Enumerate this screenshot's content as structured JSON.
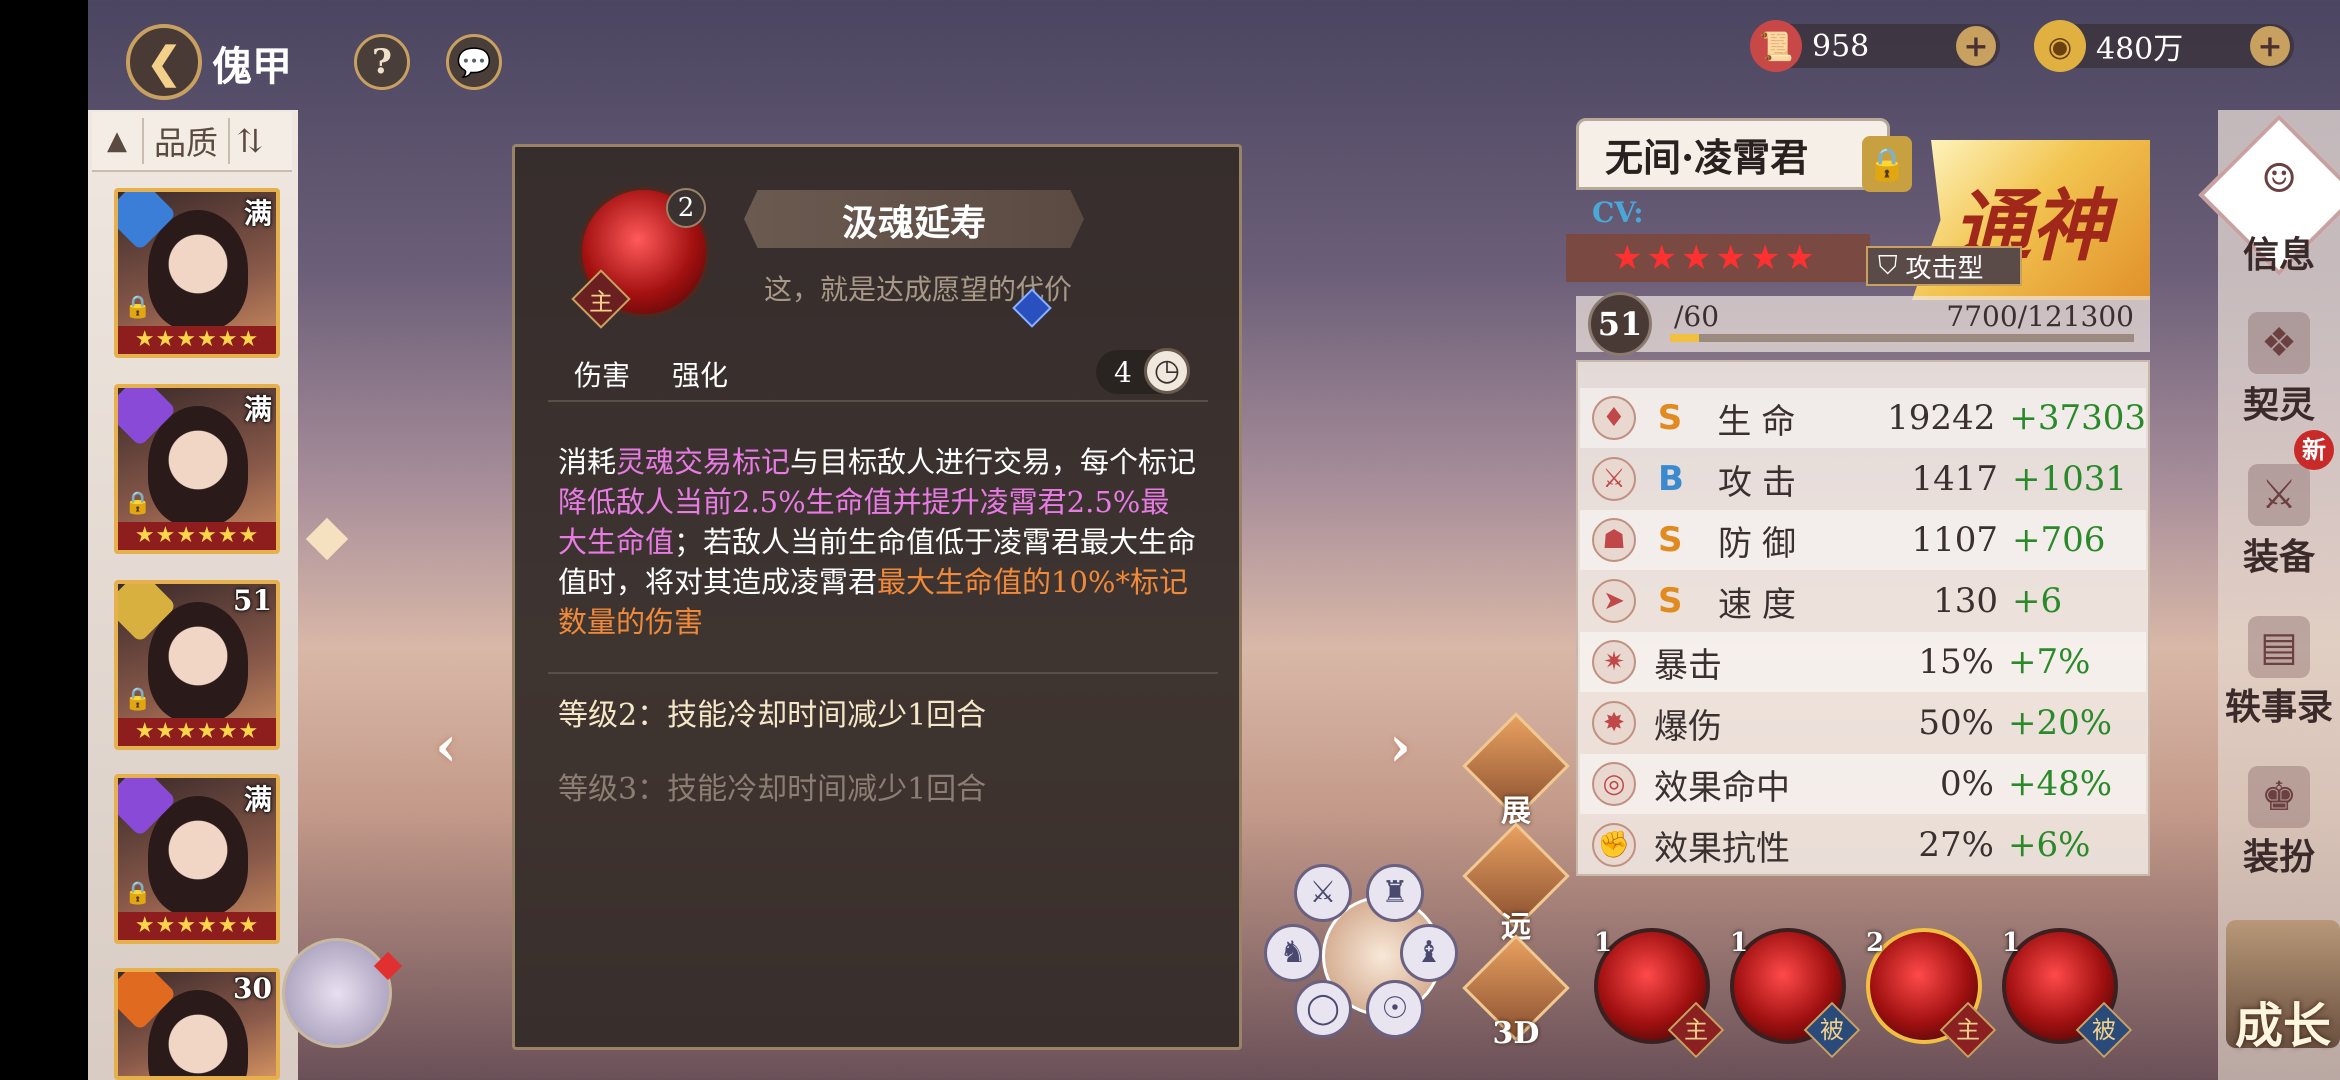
{
  "header": {
    "title": "傀甲",
    "help_label": "?",
    "chat_label": "💬"
  },
  "currency": {
    "scroll_value": "958",
    "coin_value": "480万",
    "plus": "+"
  },
  "hero_list": {
    "sort_arrow": "▲",
    "filter_label": "品质",
    "sort_toggle": "⇅",
    "cards": [
      {
        "badge": "满",
        "stars": "★★★★★★",
        "elem_color": "#3a7ed8"
      },
      {
        "badge": "满",
        "stars": "★★★★★★",
        "elem_color": "#8a4ad8"
      },
      {
        "badge": "51",
        "stars": "★★★★★★",
        "elem_color": "#d8b040"
      },
      {
        "badge": "满",
        "stars": "★★★★★★",
        "elem_color": "#8a4ad8"
      },
      {
        "badge": "30",
        "stars": "",
        "elem_color": "#e06a20"
      }
    ]
  },
  "skill": {
    "level": "2",
    "main_tag": "主",
    "name": "汲魂延寿",
    "subtitle": "这，就是达成愿望的代价",
    "tag1": "伤害",
    "tag2": "强化",
    "cooldown": "4",
    "desc_1": "消耗",
    "desc_2": "灵魂交易标记",
    "desc_3": "与目标敌人进行交易，每个标记",
    "desc_4": "降低敌人当前2.5%生命值并提升凌霄君2.5%最大生命值",
    "desc_5": "；若敌人当前生命值低于凌霄君最大生命值时，将对其造成凌霄君",
    "desc_6": "最大生命值的10%*标记数量的伤害",
    "level2": "等级2：技能冷却时间减少1回合",
    "level3": "等级3：技能冷却时间减少1回合"
  },
  "hero": {
    "name": "无间·凌霄君",
    "cv": "CV:",
    "stars": "★★★★★★",
    "type": "攻击型",
    "rank": "通神",
    "level": "51",
    "level_max": "/60",
    "exp": "7700/121300",
    "exp_fraction": 0.0635
  },
  "stats": [
    {
      "icon": "♦",
      "grade": "S",
      "grade_color": "#e08a20",
      "name": "生命",
      "value": "19242",
      "add": "+37303"
    },
    {
      "icon": "⚔",
      "grade": "B",
      "grade_color": "#3a8ad0",
      "name": "攻击",
      "value": "1417",
      "add": "+1031"
    },
    {
      "icon": "☗",
      "grade": "S",
      "grade_color": "#e08a20",
      "name": "防御",
      "value": "1107",
      "add": "+706"
    },
    {
      "icon": "➤",
      "grade": "S",
      "grade_color": "#e08a20",
      "name": "速度",
      "value": "130",
      "add": "+6"
    },
    {
      "icon": "✷",
      "grade": "",
      "grade_color": "#e08a20",
      "name": "暴击",
      "value": "15%",
      "add": "+7%"
    },
    {
      "icon": "✸",
      "grade": "",
      "grade_color": "#e08a20",
      "name": "爆伤",
      "value": "50%",
      "add": "+20%"
    },
    {
      "icon": "◎",
      "grade": "",
      "grade_color": "#e08a20",
      "name": "效果命中",
      "value": "0%",
      "add": "+48%"
    },
    {
      "icon": "✊",
      "grade": "",
      "grade_color": "#e08a20",
      "name": "效果抗性",
      "value": "27%",
      "add": "+6%"
    }
  ],
  "skill_orbs": [
    {
      "num": "1",
      "tag": "主",
      "tag_color": "#8a2020"
    },
    {
      "num": "1",
      "tag": "被",
      "tag_color": "#2a4a7a"
    },
    {
      "num": "2",
      "tag": "主",
      "tag_color": "#8a2020"
    },
    {
      "num": "1",
      "tag": "被",
      "tag_color": "#2a4a7a"
    }
  ],
  "mid_controls": {
    "expand": "展",
    "ranged": "远",
    "view3d": "3D"
  },
  "sidebar": {
    "info": "信息",
    "contract": "契灵",
    "equip": "装备",
    "new_badge": "新",
    "anecdote": "轶事录",
    "outfit": "装扮",
    "grow": "成长"
  }
}
